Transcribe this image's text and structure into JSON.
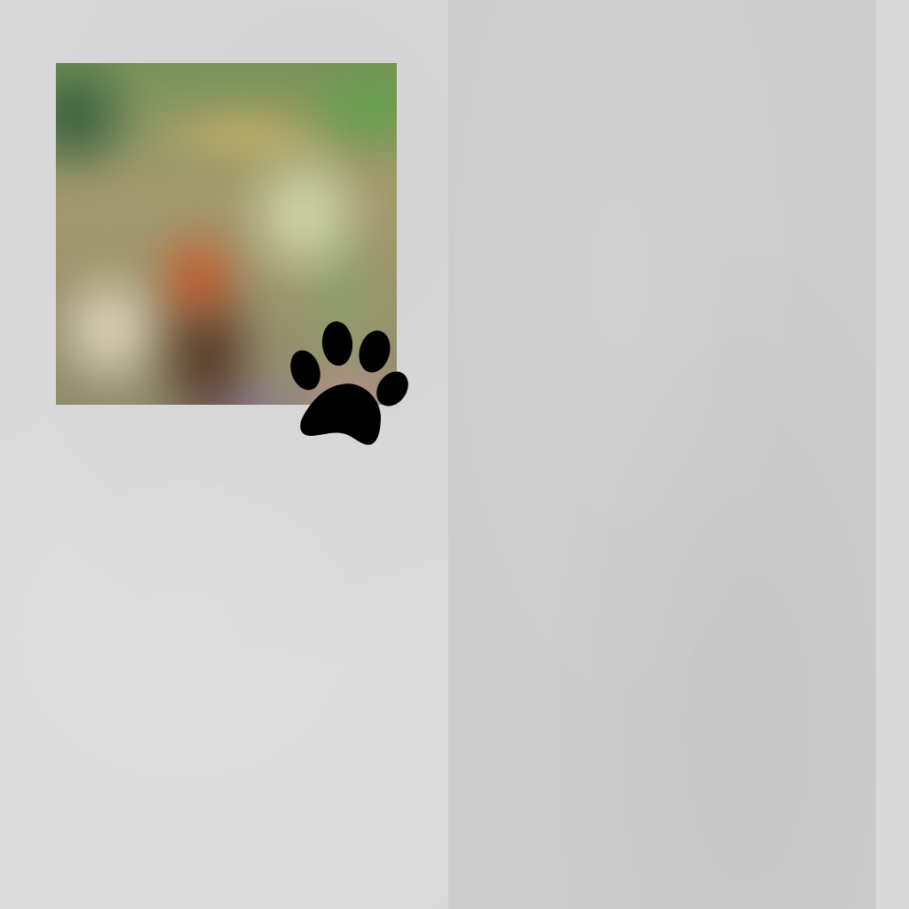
{
  "screen": {
    "background_color": "#d9d9d9",
    "right_panel_color": "#cdcdcd"
  },
  "photo_thumbnail": {
    "content": "blurred-photo"
  },
  "icons": {
    "paw": {
      "name": "paw-print-icon",
      "color": "#000000"
    }
  }
}
